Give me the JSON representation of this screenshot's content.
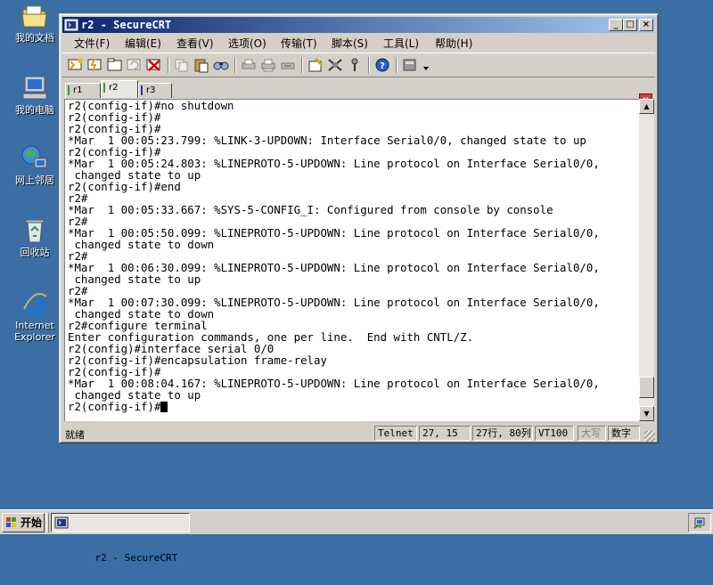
{
  "desktop": {
    "icons": [
      {
        "icon": "my-documents-icon",
        "label": "我的文档"
      },
      {
        "icon": "my-computer-icon",
        "label": "我的电脑"
      },
      {
        "icon": "network-places-icon",
        "label": "网上邻居"
      },
      {
        "icon": "recycle-bin-icon",
        "label": "回收站"
      },
      {
        "icon": "internet-explorer-icon",
        "label": "Internet Explorer"
      }
    ]
  },
  "window": {
    "title": "r2 - SecureCRT",
    "minimize": "_",
    "maximize": "□",
    "close": "×"
  },
  "menu": [
    {
      "label": "文件(F)"
    },
    {
      "label": "编辑(E)"
    },
    {
      "label": "查看(V)"
    },
    {
      "label": "选项(O)"
    },
    {
      "label": "传输(T)"
    },
    {
      "label": "脚本(S)"
    },
    {
      "label": "工具(L)"
    },
    {
      "label": "帮助(H)"
    }
  ],
  "toolbar_icons": [
    "connect-icon",
    "quick-connect-icon",
    "connect-tab-icon",
    "reconnect-icon",
    "disconnect-icon",
    "copy-icon",
    "paste-icon",
    "find-icon",
    "print-icon",
    "print-selection-icon",
    "print-setup-icon",
    "session-options-icon",
    "global-options-icon",
    "keymap-icon",
    "help-icon",
    "sftp-icon"
  ],
  "tabs": [
    {
      "label": "r1",
      "color": "#3a9a3a",
      "active": false
    },
    {
      "label": "r2",
      "color": "#3a9a3a",
      "active": true
    },
    {
      "label": "r3",
      "color": "#1e3aa8",
      "active": false
    }
  ],
  "tab_close": "×",
  "terminal": {
    "lines": [
      "r2(config-if)#no shutdown",
      "r2(config-if)#",
      "r2(config-if)#",
      "*Mar  1 00:05:23.799: %LINK-3-UPDOWN: Interface Serial0/0, changed state to up",
      "r2(config-if)#",
      "*Mar  1 00:05:24.803: %LINEPROTO-5-UPDOWN: Line protocol on Interface Serial0/0,",
      " changed state to up",
      "r2(config-if)#end",
      "r2#",
      "*Mar  1 00:05:33.667: %SYS-5-CONFIG_I: Configured from console by console",
      "r2#",
      "*Mar  1 00:05:50.099: %LINEPROTO-5-UPDOWN: Line protocol on Interface Serial0/0,",
      " changed state to down",
      "r2#",
      "*Mar  1 00:06:30.099: %LINEPROTO-5-UPDOWN: Line protocol on Interface Serial0/0,",
      " changed state to up",
      "r2#",
      "*Mar  1 00:07:30.099: %LINEPROTO-5-UPDOWN: Line protocol on Interface Serial0/0,",
      " changed state to down",
      "r2#configure terminal",
      "Enter configuration commands, one per line.  End with CNTL/Z.",
      "r2(config)#interface serial 0/0",
      "r2(config-if)#encapsulation frame-relay",
      "r2(config-if)#",
      "*Mar  1 00:08:04.167: %LINEPROTO-5-UPDOWN: Line protocol on Interface Serial0/0,",
      " changed state to up"
    ],
    "prompt": "r2(config-if)#"
  },
  "scrollbar": {
    "position": 0.97
  },
  "status": {
    "ready": "就绪",
    "protocol": "Telnet",
    "cursor_pos": "27,  15",
    "rows_cols": "27行, 80列",
    "emulation": "VT100",
    "caps": "大写",
    "num": "数字"
  },
  "taskbar": {
    "start_label": "开始",
    "task_label": "r2 - SecureCRT"
  }
}
